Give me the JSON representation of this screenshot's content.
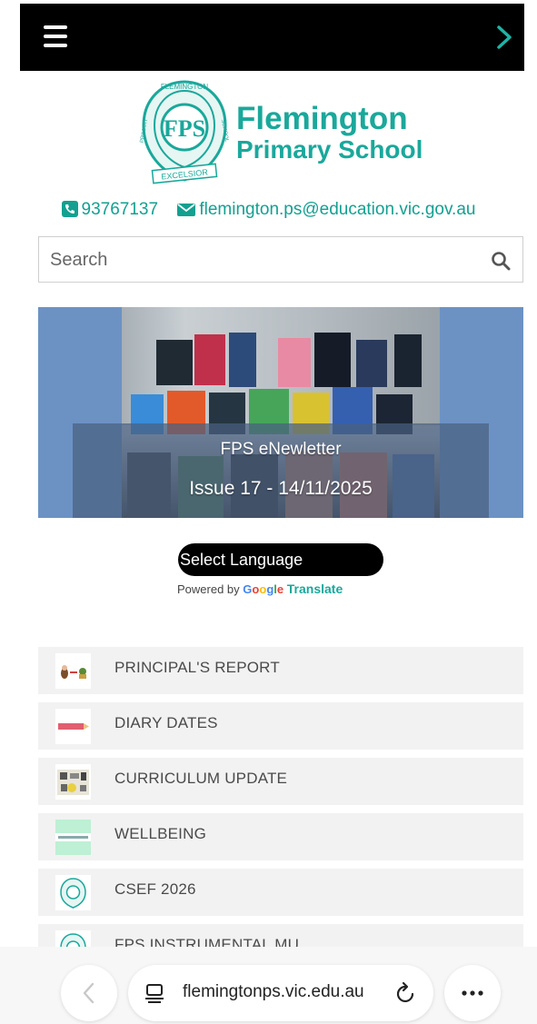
{
  "colors": {
    "brand": "#1aa89b",
    "topbar": "#000000",
    "banner_bg": "#6c92c4",
    "menu_item_bg": "#f2f2f2"
  },
  "header": {
    "menu_icon": "hamburger-icon",
    "next_icon": "chevron-right-icon"
  },
  "logo": {
    "line1": "Flemington",
    "line2": "Primary School",
    "crest_initials": "FPS",
    "crest_top": "FLEMINGTON",
    "crest_left": "PRIMARY",
    "crest_right": "SCHOOL",
    "crest_motto": "EXCELSIOR"
  },
  "contact": {
    "phone": "93767137",
    "email": "flemington.ps@education.vic.gov.au"
  },
  "search": {
    "placeholder": "Search"
  },
  "banner": {
    "title": "FPS eNewletter",
    "subtitle": "Issue 17 - 14/11/2025"
  },
  "translate": {
    "select_label": "Select Language",
    "powered_by": "Powered by",
    "google": "Google",
    "translate": "Translate"
  },
  "menu": {
    "items": [
      {
        "label": "PRINCIPAL'S REPORT"
      },
      {
        "label": "DIARY DATES"
      },
      {
        "label": "CURRICULUM UPDATE"
      },
      {
        "label": "WELLBEING"
      },
      {
        "label": "CSEF 2026"
      },
      {
        "label": "FPS INSTRUMENTAL MU"
      }
    ]
  },
  "browser": {
    "url": "flemingtonps.vic.edu.au"
  }
}
